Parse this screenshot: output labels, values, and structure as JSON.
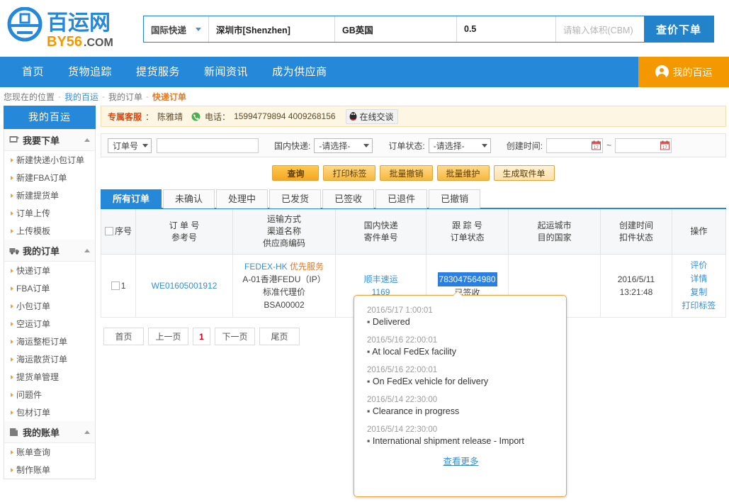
{
  "header": {
    "logo_cn": "百运网",
    "logo_latin": "BY56",
    "logo_dotcom": ".COM",
    "quote": {
      "service_type": "国际快递",
      "origin_city": "深圳市[Shenzhen]",
      "dest_country": "GB英国",
      "weight": "0.5",
      "volume_placeholder": "请输入体积(CBM)",
      "submit_label": "查价下单"
    }
  },
  "nav": {
    "items": [
      {
        "label": "首页",
        "name": "nav-home"
      },
      {
        "label": "货物追踪",
        "name": "nav-tracking"
      },
      {
        "label": "提货服务",
        "name": "nav-pickup"
      },
      {
        "label": "新闻资讯",
        "name": "nav-news"
      },
      {
        "label": "成为供应商",
        "name": "nav-supplier"
      }
    ],
    "user_label": "我的百运"
  },
  "breadcrumb": {
    "prefix": "您现在的位置",
    "sep": "-",
    "item1": "我的百运",
    "item2": "我的订单",
    "current": "快递订单"
  },
  "sidebar": {
    "title": "我的百运",
    "groups": [
      {
        "label": "我要下单",
        "icon": "order-box-icon",
        "items": [
          {
            "label": "新建快递小包订单"
          },
          {
            "label": "新建FBA订单"
          },
          {
            "label": "新建提货单"
          },
          {
            "label": "订单上传"
          },
          {
            "label": "上传模板"
          }
        ]
      },
      {
        "label": "我的订单",
        "icon": "truck-icon",
        "items": [
          {
            "label": "快递订单"
          },
          {
            "label": "FBA订单"
          },
          {
            "label": "小包订单"
          },
          {
            "label": "空运订单"
          },
          {
            "label": "海运整柜订单"
          },
          {
            "label": "海运散货订单"
          },
          {
            "label": "提货单管理"
          },
          {
            "label": "问题件"
          },
          {
            "label": "包材订单"
          }
        ]
      },
      {
        "label": "我的账单",
        "icon": "bill-icon",
        "items": [
          {
            "label": "账单查询"
          },
          {
            "label": "制作账单"
          }
        ]
      }
    ]
  },
  "service_bar": {
    "label": "专属客服",
    "colon": "：",
    "agent": "陈雅靖",
    "phone_label": "电话：",
    "phone_numbers": "15994779894 4009268156",
    "chat_label": "在线交谈"
  },
  "filters": {
    "field_select": "订单号",
    "keyword_value": "",
    "domestic_express_label": "国内快递:",
    "domestic_express_value": "-请选择-",
    "order_status_label": "订单状态:",
    "order_status_value": "-请选择-",
    "create_time_label": "创建时间:",
    "date_from": "",
    "date_to": "",
    "tilde": "~"
  },
  "action_buttons": [
    {
      "label": "查询",
      "name": "query-button",
      "style": "primary"
    },
    {
      "label": "打印标签",
      "name": "print-label-button",
      "style": "normal"
    },
    {
      "label": "批量撤销",
      "name": "batch-cancel-button",
      "style": "normal"
    },
    {
      "label": "批量维护",
      "name": "batch-maintain-button",
      "style": "normal"
    },
    {
      "label": "生成取件单",
      "name": "generate-pickup-button",
      "style": "light"
    }
  ],
  "tabs": [
    {
      "label": "所有订单",
      "active": true
    },
    {
      "label": "未确认",
      "active": false
    },
    {
      "label": "处理中",
      "active": false
    },
    {
      "label": "已发货",
      "active": false
    },
    {
      "label": "已签收",
      "active": false
    },
    {
      "label": "已退件",
      "active": false
    },
    {
      "label": "已撤销",
      "active": false
    }
  ],
  "table": {
    "headers": {
      "seq": "序号",
      "order_no": [
        "订 单 号",
        "参考号"
      ],
      "transport": [
        "运输方式",
        "渠道名称",
        "供应商编码"
      ],
      "domestic": [
        "国内快递",
        "寄件单号"
      ],
      "tracking": [
        "跟 踪 号",
        "订单状态"
      ],
      "route": [
        "起运城市",
        "目的国家"
      ],
      "created": [
        "创建时间",
        "扣件状态"
      ],
      "ops": "操作"
    },
    "rows": [
      {
        "seq": "1",
        "order_no": "WE01605001912",
        "reference": "",
        "transport_method": "FEDEX-HK",
        "transport_tag": "优先服务",
        "channel": "A-01香港FEDU（IP）",
        "price_plan": "标准代理价",
        "supplier_code": "BSA00002",
        "domestic_express": "顺丰速运",
        "domestic_no": "1169",
        "tracking_no": "783047564980",
        "order_status": "已签收",
        "created_time": "2016/5/11 13:21:48",
        "ops": [
          "评价",
          "详情",
          "复制",
          "打印标签"
        ]
      }
    ]
  },
  "pagination": [
    {
      "label": "首页",
      "type": "nav"
    },
    {
      "label": "上一页",
      "type": "nav"
    },
    {
      "label": "1",
      "type": "num"
    },
    {
      "label": "下一页",
      "type": "nav"
    },
    {
      "label": "尾页",
      "type": "nav"
    }
  ],
  "tooltip": {
    "events": [
      {
        "time": "2016/5/17 1:00:01",
        "desc": "Delivered"
      },
      {
        "time": "2016/5/16 22:00:01",
        "desc": "At local FedEx facility"
      },
      {
        "time": "2016/5/16 22:00:01",
        "desc": "On FedEx vehicle for delivery"
      },
      {
        "time": "2016/5/14 22:30:00",
        "desc": "Clearance in progress"
      },
      {
        "time": "2016/5/14 22:30:00",
        "desc": "International shipment release - Import"
      }
    ],
    "more_label": "查看更多"
  },
  "colors": {
    "brand_blue": "#2688d8",
    "accent_orange": "#f39800",
    "highlight_blue": "#2b7fe0",
    "link_blue": "#3a8fd0",
    "tooltip_border": "#e9a33a"
  }
}
